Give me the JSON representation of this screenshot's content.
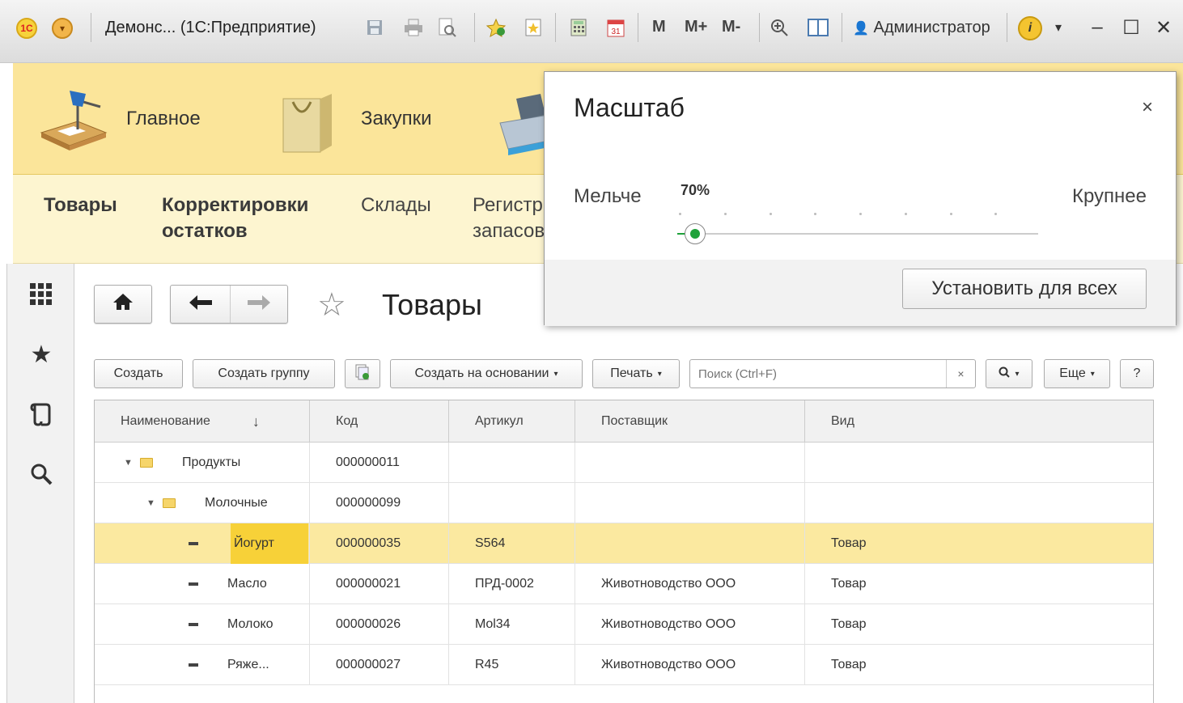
{
  "window": {
    "title": "Демонс... (1С:Предприятие)",
    "user": "Администратор",
    "mem_buttons": [
      "M",
      "M+",
      "M-"
    ]
  },
  "sections": [
    {
      "label": "Главное",
      "icon": "desk-lamp-icon"
    },
    {
      "label": "Закупки",
      "icon": "shopping-bag-icon"
    },
    {
      "label": "",
      "icon": "cash-register-icon"
    }
  ],
  "subsections": {
    "item1": "Товары",
    "item2_line1": "Корректировки",
    "item2_line2": "остатков",
    "item3": "Склады",
    "item4_line1": "Регистр",
    "item4_line2": "запасов"
  },
  "form": {
    "title": "Товары"
  },
  "commands": {
    "create": "Создать",
    "create_group": "Создать группу",
    "create_based": "Создать на основании",
    "print": "Печать",
    "search_placeholder": "Поиск (Ctrl+F)",
    "clear": "×",
    "more": "Еще",
    "help": "?"
  },
  "table": {
    "columns": [
      "Наименование",
      "Код",
      "Артикул",
      "Поставщик",
      "Вид"
    ],
    "sort_indicator": "↓",
    "rows": [
      {
        "name": "Продукты",
        "code": "000000011",
        "article": "",
        "supplier": "",
        "kind": "",
        "type": "group",
        "level": 0
      },
      {
        "name": "Молочные",
        "code": "000000099",
        "article": "",
        "supplier": "",
        "kind": "",
        "type": "group",
        "level": 1
      },
      {
        "name": "Йогурт",
        "code": "000000035",
        "article": "S564",
        "supplier": "",
        "kind": "Товар",
        "type": "item",
        "level": 2,
        "selected": true
      },
      {
        "name": "Масло",
        "code": "000000021",
        "article": "ПРД-0002",
        "supplier": "Животноводство ООО",
        "kind": "Товар",
        "type": "item",
        "level": 2
      },
      {
        "name": "Молоко",
        "code": "000000026",
        "article": "Mol34",
        "supplier": "Животноводство ООО",
        "kind": "Товар",
        "type": "item",
        "level": 2
      },
      {
        "name": "Ряже...",
        "code": "000000027",
        "article": "R45",
        "supplier": "Животноводство ООО",
        "kind": "Товар",
        "type": "item",
        "level": 2
      }
    ]
  },
  "zoom_popup": {
    "title": "Масштаб",
    "close": "×",
    "smaller": "Мельче",
    "larger": "Крупнее",
    "value_label": "70%",
    "slider_position": 0.05,
    "tick_count": 8,
    "set_all": "Установить для всех"
  },
  "colors": {
    "section_bar": "#fbe59a",
    "subsection_bar": "#fdf5d0",
    "selected_row": "#fbe9a0",
    "selected_cell": "#f7d138",
    "slider_accent": "#1fa23a"
  }
}
